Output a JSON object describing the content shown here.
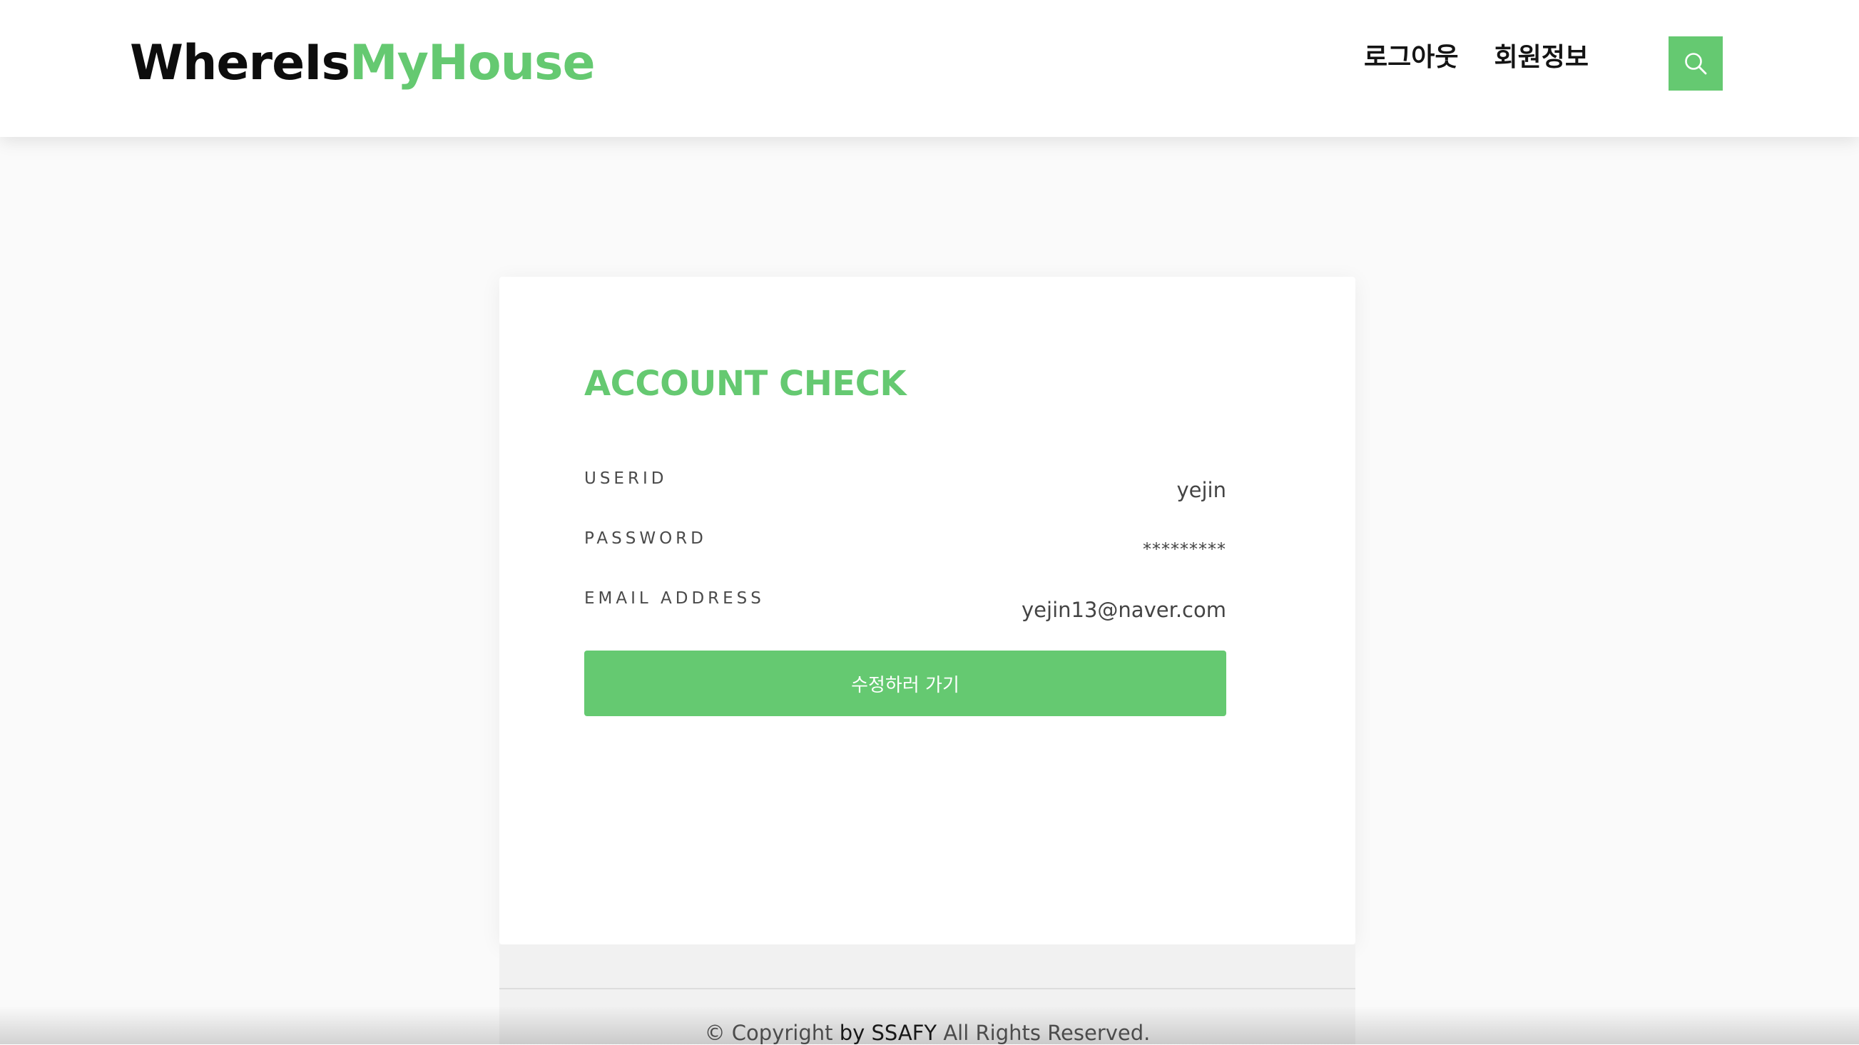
{
  "header": {
    "logo_part1": "WhereIs",
    "logo_part2": "MyHouse",
    "nav": {
      "logout": "로그아웃",
      "member_info": "회원정보"
    },
    "search_icon": "search-icon"
  },
  "account": {
    "title": "ACCOUNT CHECK",
    "fields": [
      {
        "label": "USERID",
        "value": "yejin"
      },
      {
        "label": "PASSWORD",
        "value": "*********"
      },
      {
        "label": "EMAIL ADDRESS",
        "value": "yejin13@naver.com"
      }
    ],
    "edit_button": "수정하러 가기"
  },
  "footer": {
    "copyright_prefix": "© Copyright",
    "copyright_by": "by SSAFY",
    "copyright_suffix": "All Rights Reserved."
  },
  "colors": {
    "accent": "#65c971",
    "text_dark": "#0d0d0d",
    "footer_bg": "#f1f1f1"
  }
}
